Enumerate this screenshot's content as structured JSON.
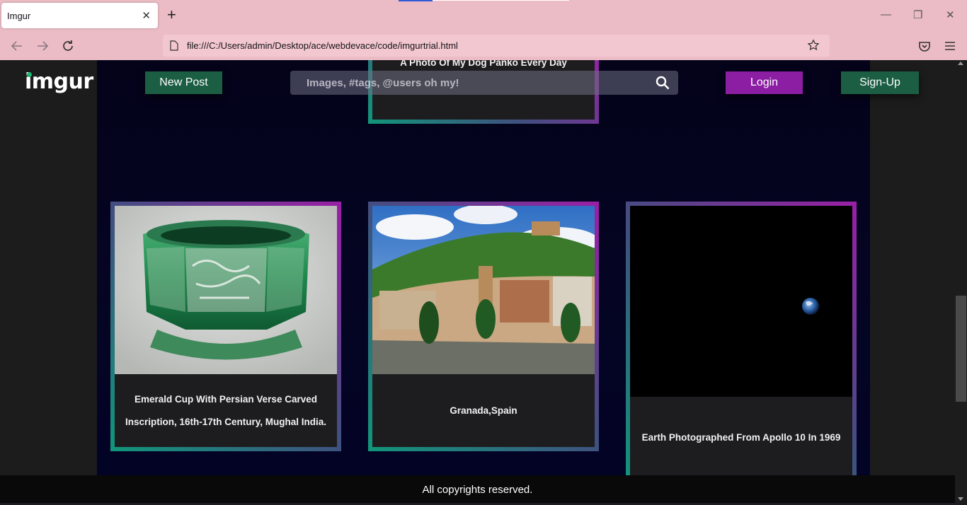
{
  "browser": {
    "tab_title": "Imgur",
    "url": "file:///C:/Users/admin/Desktop/ace/webdevace/code/imgurtrial.html"
  },
  "header": {
    "logo": "imgur",
    "new_post": "New Post",
    "search_placeholder": "Images, #tags, @users oh my!",
    "login": "Login",
    "signup": "Sign-Up"
  },
  "cards": {
    "top_caption": "A Photo Of My Dog Panko Every Day",
    "items": [
      {
        "caption_line1": "Emerald Cup With Persian Verse Carved",
        "caption_line2": "Inscription, 16th-17th Century, Mughal India."
      },
      {
        "caption": "Granada,Spain"
      },
      {
        "caption": "Earth Photographed From Apollo 10 In 1969"
      }
    ]
  },
  "footer": {
    "text": "All copyrights reserved."
  },
  "colors": {
    "green_button": "#1c5e43",
    "purple_button": "#8c1ea4",
    "card_border_start": "#11967a",
    "card_border_end": "#9b1fa6",
    "page_bg": "#04031a"
  }
}
